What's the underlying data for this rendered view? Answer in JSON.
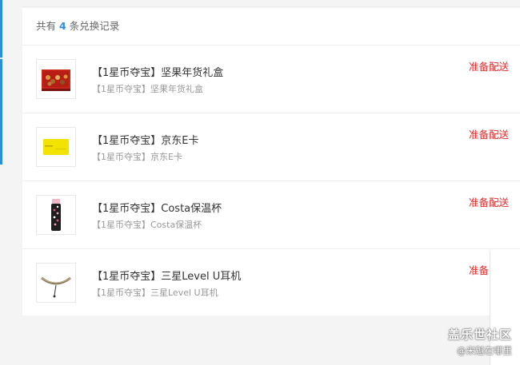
{
  "summary": {
    "prefix": "共有",
    "count": "4",
    "suffix": "条兑换记录"
  },
  "orders": [
    {
      "title": "【1星币夺宝】坚果年货礼盒",
      "subtitle": "【1星币夺宝】坚果年货礼盒",
      "status": "准备配送",
      "thumb_icon": "nut-gift-box-icon"
    },
    {
      "title": "【1星币夺宝】京东E卡",
      "subtitle": "【1星币夺宝】京东E卡",
      "status": "准备配送",
      "thumb_icon": "jd-ecard-icon"
    },
    {
      "title": "【1星币夺宝】Costa保温杯",
      "subtitle": "【1星币夺宝】Costa保温杯",
      "status": "准备配送",
      "thumb_icon": "thermos-cup-icon"
    },
    {
      "title": "【1星币夺宝】三星Level U耳机",
      "subtitle": "【1星币夺宝】三星Level U耳机",
      "status": "准备配送",
      "thumb_icon": "neckband-headphones-icon"
    }
  ],
  "watermark": {
    "line1": "盖乐世社区",
    "line2": "@米魁在哪里"
  },
  "colors": {
    "accent": "#2a8fd6",
    "status": "#e02b2b"
  }
}
